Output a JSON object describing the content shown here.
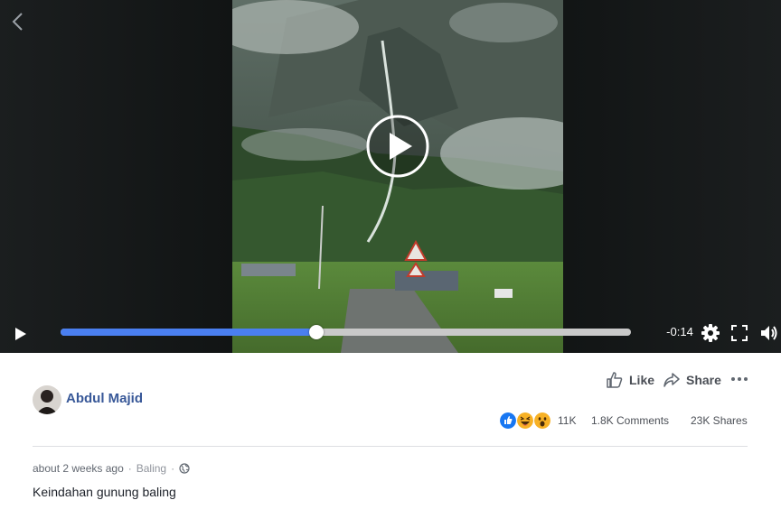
{
  "video": {
    "remaining_time": "-0:14",
    "progress_fraction": 0.448,
    "icons": [
      "chevron-left-icon",
      "play-icon",
      "settings-gear-icon",
      "fullscreen-icon",
      "volume-icon"
    ]
  },
  "post": {
    "author": "Abdul Majid",
    "actions": {
      "like": "Like",
      "share": "Share"
    },
    "reactions": {
      "types": [
        "like",
        "haha",
        "wow"
      ],
      "count": "11K"
    },
    "comments": "1.8K Comments",
    "shares": "23K Shares",
    "timestamp": "about 2 weeks ago",
    "location": "Baling",
    "privacy_icon": "globe-icon",
    "caption": "Keindahan gunung baling"
  },
  "colors": {
    "link": "#385898",
    "progress": "#4a7ff0",
    "text": "#1d2129",
    "muted": "#616770"
  }
}
